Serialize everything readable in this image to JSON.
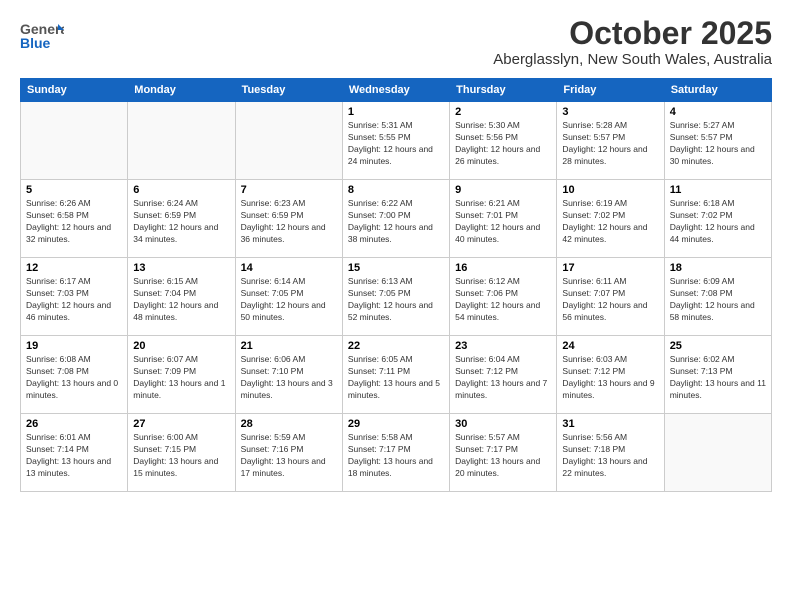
{
  "logo": {
    "line1": "General",
    "line2": "Blue"
  },
  "header": {
    "month": "October 2025",
    "location": "Aberglasslyn, New South Wales, Australia"
  },
  "weekdays": [
    "Sunday",
    "Monday",
    "Tuesday",
    "Wednesday",
    "Thursday",
    "Friday",
    "Saturday"
  ],
  "weeks": [
    [
      {
        "day": "",
        "sunrise": "",
        "sunset": "",
        "daylight": ""
      },
      {
        "day": "",
        "sunrise": "",
        "sunset": "",
        "daylight": ""
      },
      {
        "day": "",
        "sunrise": "",
        "sunset": "",
        "daylight": ""
      },
      {
        "day": "1",
        "sunrise": "Sunrise: 5:31 AM",
        "sunset": "Sunset: 5:55 PM",
        "daylight": "Daylight: 12 hours and 24 minutes."
      },
      {
        "day": "2",
        "sunrise": "Sunrise: 5:30 AM",
        "sunset": "Sunset: 5:56 PM",
        "daylight": "Daylight: 12 hours and 26 minutes."
      },
      {
        "day": "3",
        "sunrise": "Sunrise: 5:28 AM",
        "sunset": "Sunset: 5:57 PM",
        "daylight": "Daylight: 12 hours and 28 minutes."
      },
      {
        "day": "4",
        "sunrise": "Sunrise: 5:27 AM",
        "sunset": "Sunset: 5:57 PM",
        "daylight": "Daylight: 12 hours and 30 minutes."
      }
    ],
    [
      {
        "day": "5",
        "sunrise": "Sunrise: 6:26 AM",
        "sunset": "Sunset: 6:58 PM",
        "daylight": "Daylight: 12 hours and 32 minutes."
      },
      {
        "day": "6",
        "sunrise": "Sunrise: 6:24 AM",
        "sunset": "Sunset: 6:59 PM",
        "daylight": "Daylight: 12 hours and 34 minutes."
      },
      {
        "day": "7",
        "sunrise": "Sunrise: 6:23 AM",
        "sunset": "Sunset: 6:59 PM",
        "daylight": "Daylight: 12 hours and 36 minutes."
      },
      {
        "day": "8",
        "sunrise": "Sunrise: 6:22 AM",
        "sunset": "Sunset: 7:00 PM",
        "daylight": "Daylight: 12 hours and 38 minutes."
      },
      {
        "day": "9",
        "sunrise": "Sunrise: 6:21 AM",
        "sunset": "Sunset: 7:01 PM",
        "daylight": "Daylight: 12 hours and 40 minutes."
      },
      {
        "day": "10",
        "sunrise": "Sunrise: 6:19 AM",
        "sunset": "Sunset: 7:02 PM",
        "daylight": "Daylight: 12 hours and 42 minutes."
      },
      {
        "day": "11",
        "sunrise": "Sunrise: 6:18 AM",
        "sunset": "Sunset: 7:02 PM",
        "daylight": "Daylight: 12 hours and 44 minutes."
      }
    ],
    [
      {
        "day": "12",
        "sunrise": "Sunrise: 6:17 AM",
        "sunset": "Sunset: 7:03 PM",
        "daylight": "Daylight: 12 hours and 46 minutes."
      },
      {
        "day": "13",
        "sunrise": "Sunrise: 6:15 AM",
        "sunset": "Sunset: 7:04 PM",
        "daylight": "Daylight: 12 hours and 48 minutes."
      },
      {
        "day": "14",
        "sunrise": "Sunrise: 6:14 AM",
        "sunset": "Sunset: 7:05 PM",
        "daylight": "Daylight: 12 hours and 50 minutes."
      },
      {
        "day": "15",
        "sunrise": "Sunrise: 6:13 AM",
        "sunset": "Sunset: 7:05 PM",
        "daylight": "Daylight: 12 hours and 52 minutes."
      },
      {
        "day": "16",
        "sunrise": "Sunrise: 6:12 AM",
        "sunset": "Sunset: 7:06 PM",
        "daylight": "Daylight: 12 hours and 54 minutes."
      },
      {
        "day": "17",
        "sunrise": "Sunrise: 6:11 AM",
        "sunset": "Sunset: 7:07 PM",
        "daylight": "Daylight: 12 hours and 56 minutes."
      },
      {
        "day": "18",
        "sunrise": "Sunrise: 6:09 AM",
        "sunset": "Sunset: 7:08 PM",
        "daylight": "Daylight: 12 hours and 58 minutes."
      }
    ],
    [
      {
        "day": "19",
        "sunrise": "Sunrise: 6:08 AM",
        "sunset": "Sunset: 7:08 PM",
        "daylight": "Daylight: 13 hours and 0 minutes."
      },
      {
        "day": "20",
        "sunrise": "Sunrise: 6:07 AM",
        "sunset": "Sunset: 7:09 PM",
        "daylight": "Daylight: 13 hours and 1 minute."
      },
      {
        "day": "21",
        "sunrise": "Sunrise: 6:06 AM",
        "sunset": "Sunset: 7:10 PM",
        "daylight": "Daylight: 13 hours and 3 minutes."
      },
      {
        "day": "22",
        "sunrise": "Sunrise: 6:05 AM",
        "sunset": "Sunset: 7:11 PM",
        "daylight": "Daylight: 13 hours and 5 minutes."
      },
      {
        "day": "23",
        "sunrise": "Sunrise: 6:04 AM",
        "sunset": "Sunset: 7:12 PM",
        "daylight": "Daylight: 13 hours and 7 minutes."
      },
      {
        "day": "24",
        "sunrise": "Sunrise: 6:03 AM",
        "sunset": "Sunset: 7:12 PM",
        "daylight": "Daylight: 13 hours and 9 minutes."
      },
      {
        "day": "25",
        "sunrise": "Sunrise: 6:02 AM",
        "sunset": "Sunset: 7:13 PM",
        "daylight": "Daylight: 13 hours and 11 minutes."
      }
    ],
    [
      {
        "day": "26",
        "sunrise": "Sunrise: 6:01 AM",
        "sunset": "Sunset: 7:14 PM",
        "daylight": "Daylight: 13 hours and 13 minutes."
      },
      {
        "day": "27",
        "sunrise": "Sunrise: 6:00 AM",
        "sunset": "Sunset: 7:15 PM",
        "daylight": "Daylight: 13 hours and 15 minutes."
      },
      {
        "day": "28",
        "sunrise": "Sunrise: 5:59 AM",
        "sunset": "Sunset: 7:16 PM",
        "daylight": "Daylight: 13 hours and 17 minutes."
      },
      {
        "day": "29",
        "sunrise": "Sunrise: 5:58 AM",
        "sunset": "Sunset: 7:17 PM",
        "daylight": "Daylight: 13 hours and 18 minutes."
      },
      {
        "day": "30",
        "sunrise": "Sunrise: 5:57 AM",
        "sunset": "Sunset: 7:17 PM",
        "daylight": "Daylight: 13 hours and 20 minutes."
      },
      {
        "day": "31",
        "sunrise": "Sunrise: 5:56 AM",
        "sunset": "Sunset: 7:18 PM",
        "daylight": "Daylight: 13 hours and 22 minutes."
      },
      {
        "day": "",
        "sunrise": "",
        "sunset": "",
        "daylight": ""
      }
    ]
  ]
}
